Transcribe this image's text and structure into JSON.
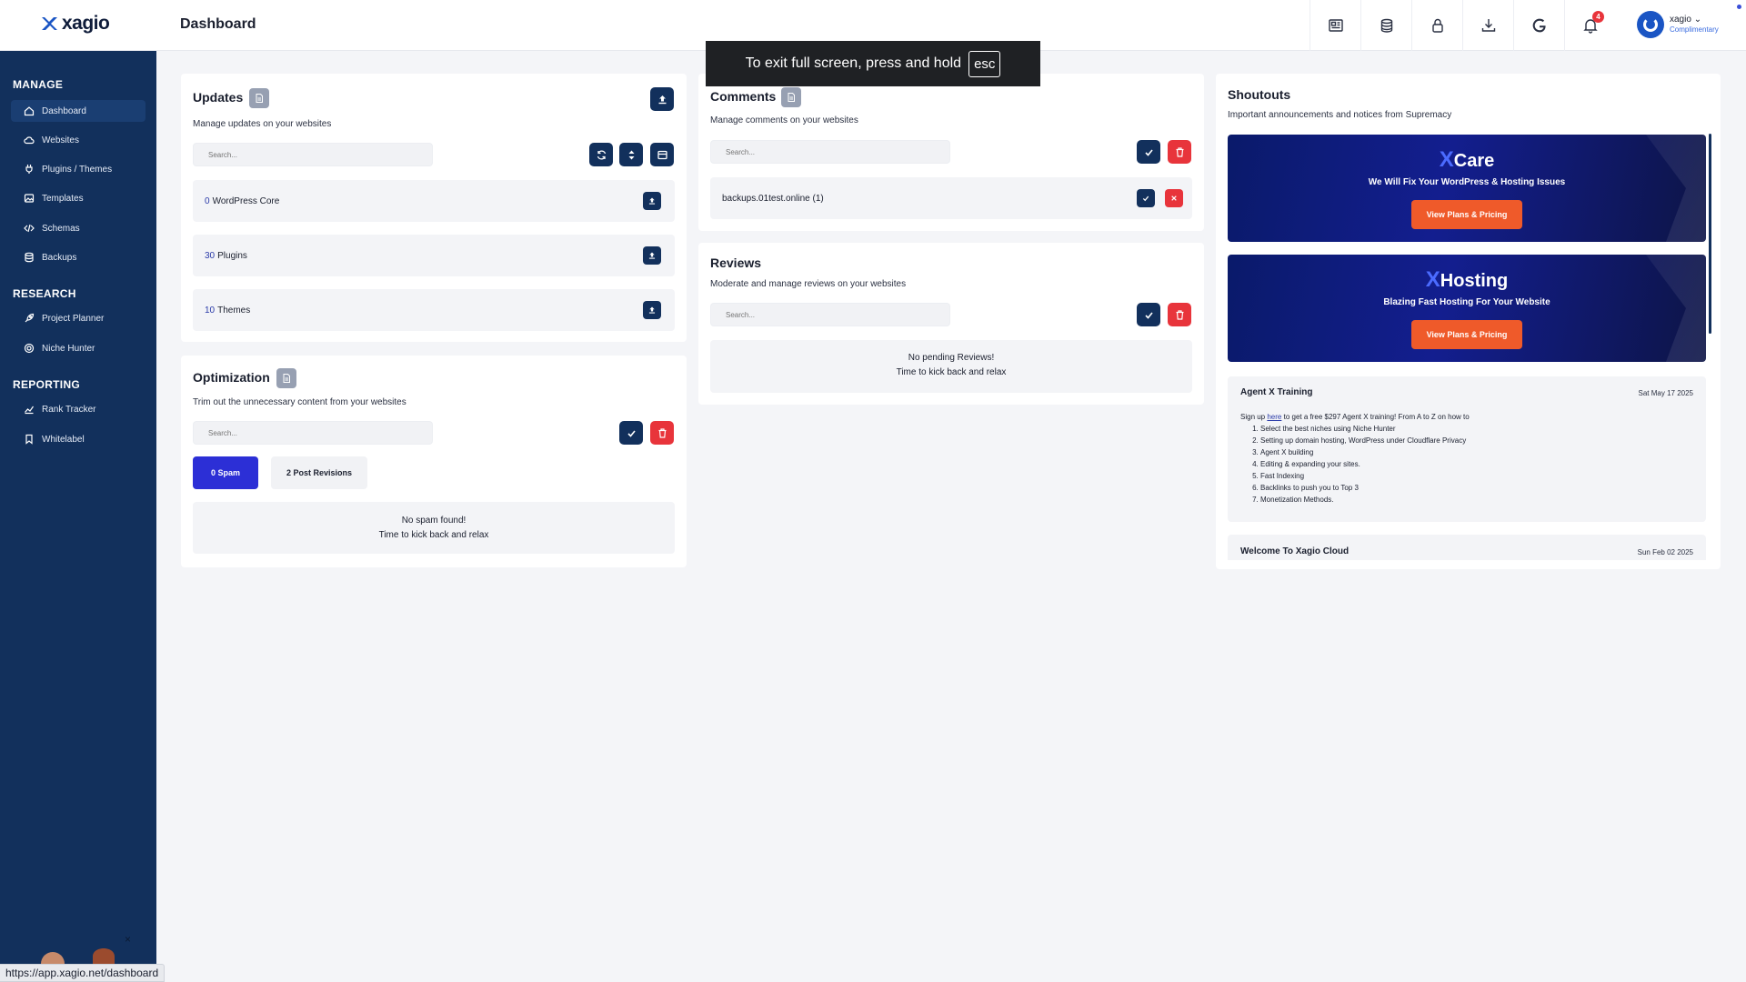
{
  "app": {
    "brand": "xagio",
    "page_title": "Dashboard"
  },
  "user": {
    "name": "xagio",
    "plan": "Complimentary"
  },
  "notifications": {
    "count": "4"
  },
  "topbar_icons": [
    "newspaper-icon",
    "coins-icon",
    "lock-icon",
    "download-icon",
    "google-icon",
    "bell-icon"
  ],
  "sidebar": {
    "sections": [
      {
        "label": "MANAGE",
        "items": [
          {
            "label": "Dashboard",
            "icon": "home-icon"
          },
          {
            "label": "Websites",
            "icon": "cloud-icon"
          },
          {
            "label": "Plugins / Themes",
            "icon": "plug-icon"
          },
          {
            "label": "Templates",
            "icon": "image-icon"
          },
          {
            "label": "Schemas",
            "icon": "code-icon"
          },
          {
            "label": "Backups",
            "icon": "database-icon"
          }
        ]
      },
      {
        "label": "RESEARCH",
        "items": [
          {
            "label": "Project Planner",
            "icon": "rocket-icon"
          },
          {
            "label": "Niche Hunter",
            "icon": "target-icon"
          }
        ]
      },
      {
        "label": "REPORTING",
        "items": [
          {
            "label": "Rank Tracker",
            "icon": "chart-icon"
          },
          {
            "label": "Whitelabel",
            "icon": "bookmark-icon"
          }
        ]
      }
    ],
    "promo_close": "×"
  },
  "updates": {
    "title": "Updates",
    "subtitle": "Manage updates on your websites",
    "search_placeholder": "Search...",
    "rows": [
      {
        "count": "0",
        "label": "WordPress Core"
      },
      {
        "count": "30",
        "label": "Plugins"
      },
      {
        "count": "10",
        "label": "Themes"
      }
    ]
  },
  "optimization": {
    "title": "Optimization",
    "subtitle": "Trim out the unnecessary content from your websites",
    "search_placeholder": "Search...",
    "tab_spam": "0 Spam",
    "tab_revisions": "2 Post Revisions",
    "empty_line1": "No spam found!",
    "empty_line2": "Time to kick back and relax"
  },
  "comments": {
    "title": "Comments",
    "subtitle": "Manage comments on your websites",
    "search_placeholder": "Search...",
    "row_label": "backups.01test.online (1)"
  },
  "reviews": {
    "title": "Reviews",
    "subtitle": "Moderate and manage reviews on your websites",
    "search_placeholder": "Search...",
    "empty_line1": "No pending Reviews!",
    "empty_line2": "Time to kick back and relax"
  },
  "shoutouts": {
    "title": "Shoutouts",
    "subtitle": "Important announcements and notices from Supremacy",
    "banners": [
      {
        "x": "X",
        "title": "Care",
        "subtitle": "We Will Fix Your WordPress & Hosting Issues",
        "button": "View Plans & Pricing"
      },
      {
        "x": "X",
        "title": "Hosting",
        "subtitle": "Blazing Fast Hosting For Your Website",
        "button": "View Plans & Pricing"
      }
    ],
    "posts": [
      {
        "title": "Agent X Training",
        "date": "Sat May 17 2025",
        "intro_before": "Sign up ",
        "link": "here",
        "intro_after": " to get a free $297 Agent X training!  From A to Z on how to",
        "items": [
          "Select the best niches using Niche Hunter",
          "Setting up domain hosting, WordPress under Cloudflare Privacy",
          "Agent X building",
          "Editing & expanding your sites.",
          "Fast Indexing",
          "Backlinks to push you to Top 3",
          "Monetization Methods."
        ]
      },
      {
        "title": "Welcome To Xagio Cloud",
        "date": "Sun Feb 02 2025"
      }
    ]
  },
  "fullscreen_toast": {
    "text": "To exit full screen, press and hold",
    "key": "esc"
  },
  "status_url": "https://app.xagio.net/dashboard",
  "colors": {
    "navy": "#12305c",
    "red": "#e8343b",
    "accent_blue": "#2c2fd6",
    "orange": "#ef5a2a"
  }
}
